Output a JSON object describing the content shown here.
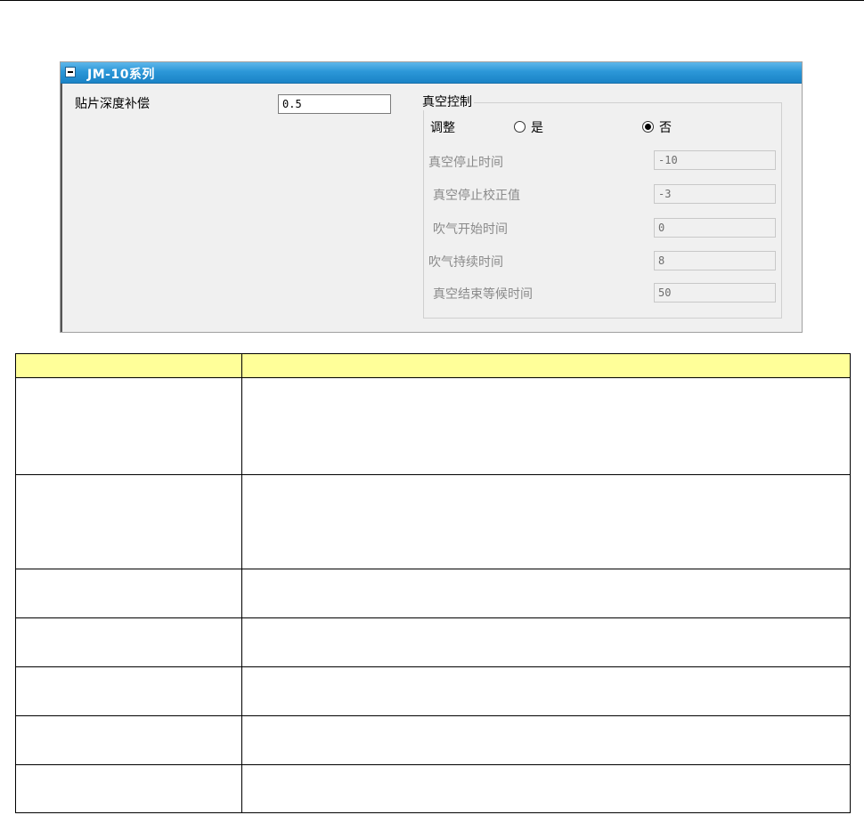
{
  "panel": {
    "title": "JM-10系列",
    "depth_comp": {
      "label": "贴片深度补偿",
      "value": "0.5"
    },
    "vacuum_group": {
      "title": "真空控制",
      "adjust_label": "调整",
      "options": [
        {
          "label": "是",
          "checked": false
        },
        {
          "label": "否",
          "checked": true
        }
      ],
      "fields": [
        {
          "label": "真空停止时间",
          "value": "-10"
        },
        {
          "label": "真空停止校正值",
          "value": "-3"
        },
        {
          "label": "吹气开始时间",
          "value": "0"
        },
        {
          "label": "吹气持续时间",
          "value": "8"
        },
        {
          "label": "真空结束等候时间",
          "value": "50"
        }
      ]
    }
  },
  "table": {
    "header": [
      "",
      ""
    ],
    "rows": [
      [
        "",
        ""
      ],
      [
        "",
        ""
      ],
      [
        "",
        ""
      ],
      [
        "",
        ""
      ],
      [
        "",
        ""
      ],
      [
        "",
        ""
      ],
      [
        "",
        ""
      ]
    ]
  }
}
